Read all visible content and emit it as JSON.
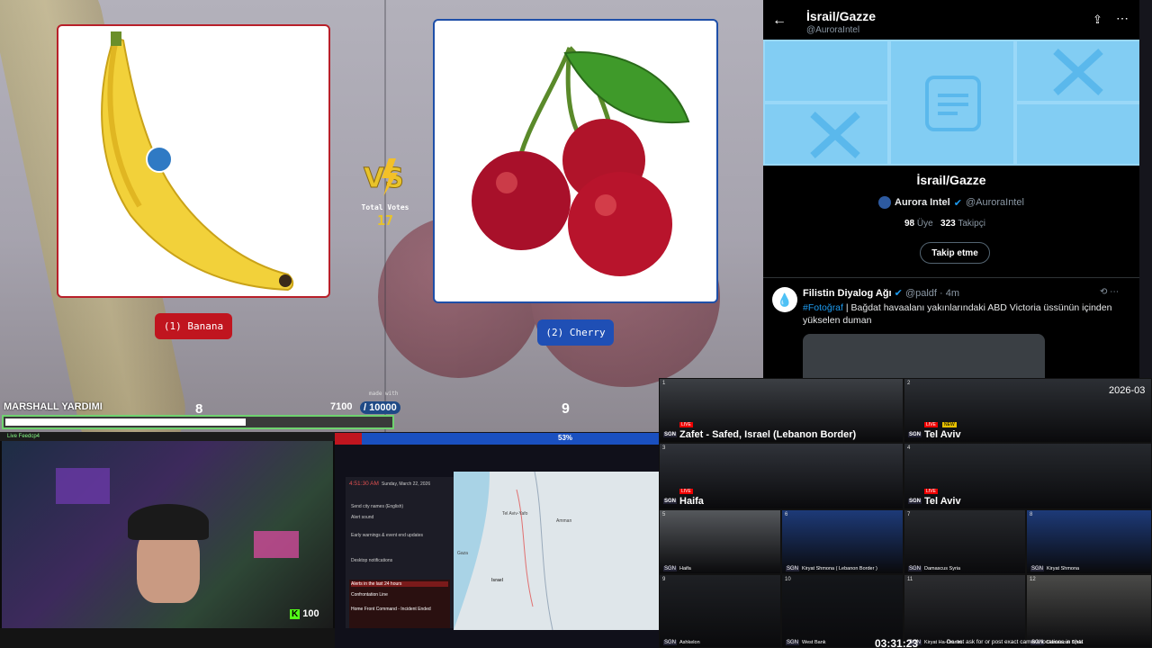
{
  "poll": {
    "option1": "(1) Banana",
    "option2": "(2) Cherry",
    "total_votes_label": "Total Votes",
    "total_votes": "17",
    "vs": "VS"
  },
  "donation": {
    "name": "MARSHALL YARDIMI",
    "left_count": "8",
    "current": "7100",
    "goal": "/ 10000",
    "made_with": "made with",
    "right_count": "9",
    "progress": 0.71,
    "vote_split_pct": "53%"
  },
  "twitter": {
    "header_title": "İsrail/Gazze",
    "header_handle": "@AuroraIntel",
    "list_name": "İsrail/Gazze",
    "owner_name": "Aurora Intel",
    "owner_handle": "@AuroraIntel",
    "members_count": "98",
    "members_label": "Üye",
    "followers_count": "323",
    "followers_label": "Takipçi",
    "follow_button": "Takip etme",
    "tweet": {
      "author": "Filistin Diyalog Ağı",
      "handle": "@paldf",
      "time": "4m",
      "hashtag": "#Fotoğraf",
      "text": " | Bağdat havaalanı yakınlarındaki ABD Victoria üssünün içinden yükselen duman"
    }
  },
  "webcam": {
    "title": "Live Feedcp4",
    "viewer_count": "100",
    "k_label": "K"
  },
  "alert_app": {
    "time": "4:51:30 AM",
    "date": "Sunday, March 22, 2026",
    "alerts_header": "Alerts in the last 24 hours",
    "row1": "Send city names (English)",
    "row2": "Alert sound",
    "row3": "Early warnings & event end updates",
    "row4": "Desktop notifications",
    "item1": "Confrontation Line",
    "item2": "Home Front Command - Incident Ended",
    "map_city1": "Tel Aviv-Yafo",
    "map_city2": "Amman",
    "map_city3": "Israel",
    "map_city4": "Gaza"
  },
  "cams": {
    "date": "2026-03",
    "clock": "03:31:23",
    "ticker": "Do not ask for or post exact camera locations in chat",
    "cells": [
      {
        "num": "1",
        "caption": "Zafet - Safed, Israel (Lebanon Border)"
      },
      {
        "num": "2",
        "caption": "Tel Aviv"
      },
      {
        "num": "3",
        "caption": "Haifa"
      },
      {
        "num": "4",
        "caption": "Tel Aviv"
      },
      {
        "num": "5",
        "caption": "Haifa"
      },
      {
        "num": "6",
        "caption": "Kiryat Shmona ( Lebanon Border )"
      },
      {
        "num": "7",
        "caption": "Damascus Syria"
      },
      {
        "num": "8",
        "caption": "Kiryat Shmona"
      },
      {
        "num": "9",
        "caption": "Ashkelon"
      },
      {
        "num": "10",
        "caption": "West Bank"
      },
      {
        "num": "11",
        "caption": "Kiryat Ha-Oranim"
      },
      {
        "num": "12",
        "caption": "Damascus Syria"
      }
    ],
    "new_badge": "NEW",
    "live_badge": "LIVE",
    "sgn": "SGN"
  }
}
